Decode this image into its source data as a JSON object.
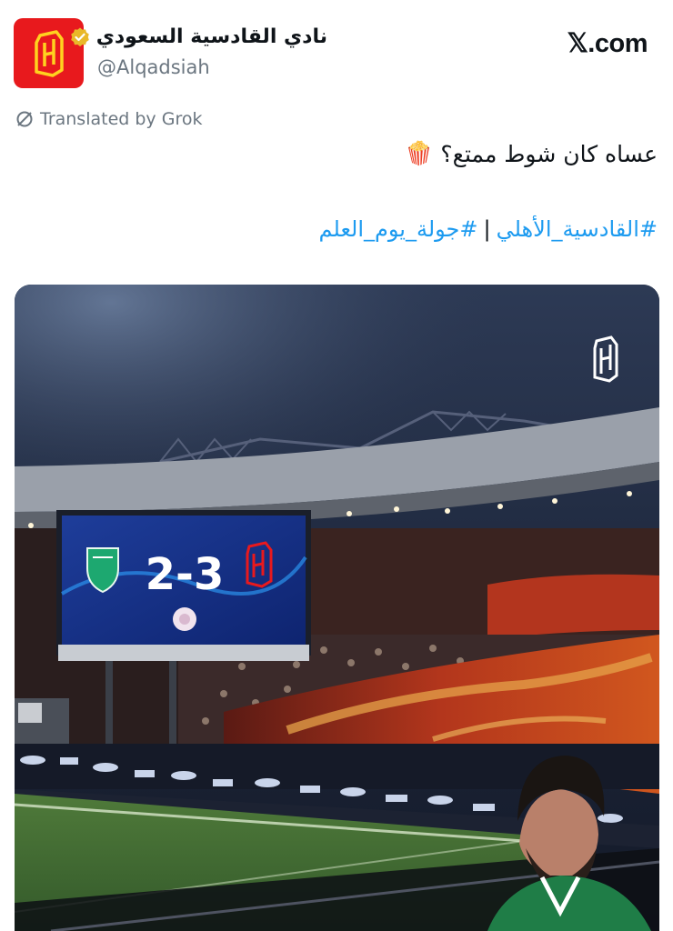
{
  "account": {
    "display_name": "نادي القادسية السعودي",
    "handle": "@Alqadsiah",
    "verified": true
  },
  "site": {
    "label": "𝕏.com"
  },
  "translation": {
    "label": "Translated by Grok"
  },
  "tweet": {
    "text": "عساه كان شوط ممتع؟",
    "emoji": "🍿",
    "hashtags": [
      "#جولة_يوم_العلم",
      "#القادسية_الأهلي"
    ],
    "hashtag_separator": "|"
  },
  "scoreboard": {
    "score": "2-3"
  },
  "colors": {
    "brand_red": "#e8191d",
    "link_blue": "#1d9bf0",
    "verified_gold": "#e9b829",
    "secondary_text": "#6b7680"
  }
}
